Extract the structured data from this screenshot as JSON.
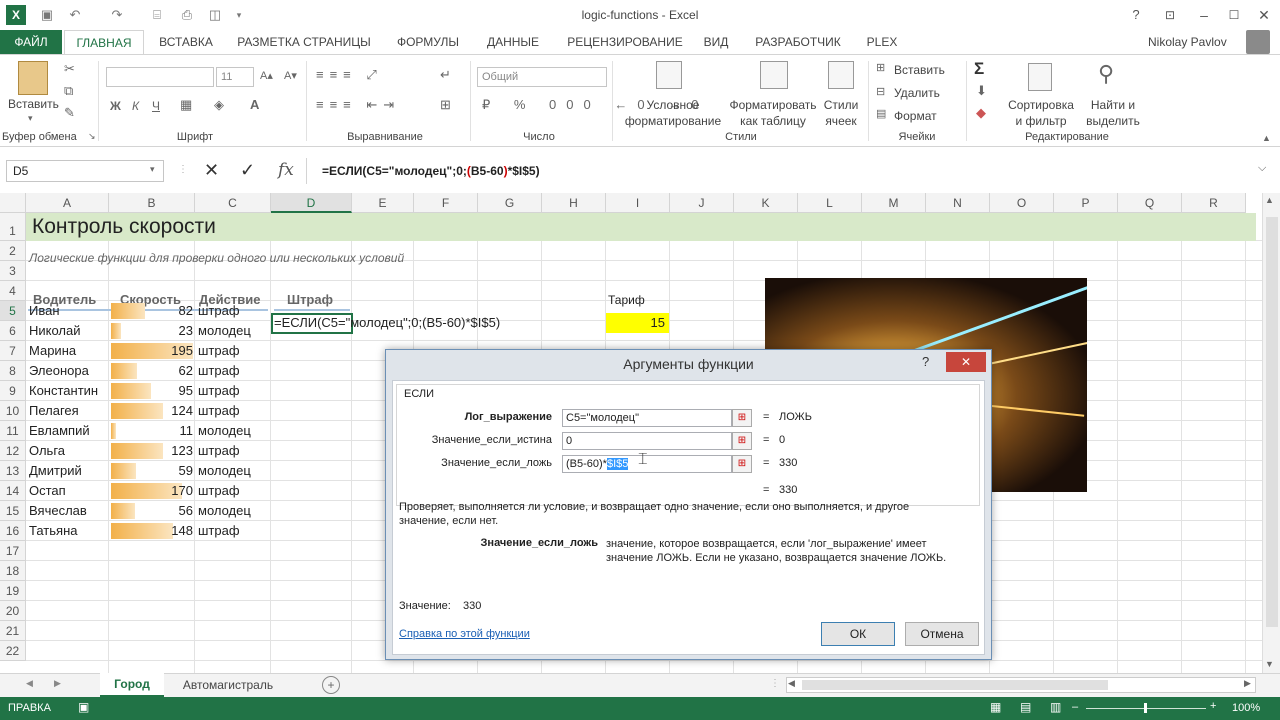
{
  "window": {
    "title": "logic-functions - Excel",
    "user": "Nikolay Pavlov"
  },
  "tabs": [
    "ФАЙЛ",
    "ГЛАВНАЯ",
    "ВСТАВКА",
    "РАЗМЕТКА СТРАНИЦЫ",
    "ФОРМУЛЫ",
    "ДАННЫЕ",
    "РЕЦЕНЗИРОВАНИЕ",
    "ВИД",
    "РАЗРАБОТЧИК",
    "PLEX"
  ],
  "ribbon": {
    "paste": "Вставить",
    "clipboard": "Буфер обмена",
    "font": "Шрифт",
    "font_size": "11",
    "bold": "Ж",
    "italic": "К",
    "underline": "Ч",
    "alignment": "Выравнивание",
    "number_format": "Общий",
    "number": "Число",
    "cond_format": [
      "Условное",
      "форматирование"
    ],
    "table_format": [
      "Форматировать",
      "как таблицу"
    ],
    "cell_styles": [
      "Стили",
      "ячеек"
    ],
    "styles": "Стили",
    "insert": "Вставить",
    "delete": "Удалить",
    "format": "Формат",
    "cells": "Ячейки",
    "sort": [
      "Сортировка",
      "и фильтр"
    ],
    "find": [
      "Найти и",
      "выделить"
    ],
    "editing": "Редактирование"
  },
  "formula_bar": {
    "name_box": "D5",
    "fx": "fx",
    "formula_parts": [
      "=ЕСЛИ(C5=\"молодец\";0;",
      "(",
      "B5-60",
      ")",
      "*$I$5)"
    ]
  },
  "columns": [
    "A",
    "B",
    "C",
    "D",
    "E",
    "F",
    "G",
    "H",
    "I",
    "J",
    "K",
    "L",
    "M",
    "N",
    "O",
    "P",
    "Q",
    "R"
  ],
  "rows": [
    "1",
    "2",
    "3",
    "4",
    "5",
    "6",
    "7",
    "8",
    "9",
    "10",
    "11",
    "12",
    "13",
    "14",
    "15",
    "16",
    "17",
    "18",
    "19",
    "20",
    "21",
    "22"
  ],
  "sheet": {
    "title": "Контроль скорости",
    "subtitle": "Логические функции для проверки одного или нескольких условий",
    "headers": {
      "driver": "Водитель",
      "speed": "Скорость",
      "action": "Действие",
      "fine": "Штраф",
      "rate": "Тариф"
    },
    "rate_value": "15",
    "d5_edit": "=ЕСЛИ(C5=\"молодец\";0;(B5-60)*$I$5)",
    "data": [
      {
        "name": "Иван",
        "speed": 82,
        "action": "штраф"
      },
      {
        "name": "Николай",
        "speed": 23,
        "action": "молодец"
      },
      {
        "name": "Марина",
        "speed": 195,
        "action": "штраф"
      },
      {
        "name": "Элеонора",
        "speed": 62,
        "action": "штраф"
      },
      {
        "name": "Константин",
        "speed": 95,
        "action": "штраф"
      },
      {
        "name": "Пелагея",
        "speed": 124,
        "action": "штраф"
      },
      {
        "name": "Евлампий",
        "speed": 11,
        "action": "молодец"
      },
      {
        "name": "Ольга",
        "speed": 123,
        "action": "штраф"
      },
      {
        "name": "Дмитрий",
        "speed": 59,
        "action": "молодец"
      },
      {
        "name": "Остап",
        "speed": 170,
        "action": "штраф"
      },
      {
        "name": "Вячеслав",
        "speed": 56,
        "action": "молодец"
      },
      {
        "name": "Татьяна",
        "speed": 148,
        "action": "штраф"
      }
    ],
    "speed_max": 195
  },
  "dialog": {
    "title": "Аргументы функции",
    "help_q": "?",
    "close": "✕",
    "func": "ЕСЛИ",
    "args": [
      {
        "label": "Лог_выражение",
        "value": "C5=\"молодец\"",
        "result": "ЛОЖЬ"
      },
      {
        "label": "Значение_если_истина",
        "value": "0",
        "result": "0"
      },
      {
        "label": "Значение_если_ложь",
        "value_prefix": "(B5-60)*",
        "value_sel": "$I$5",
        "result": "330"
      }
    ],
    "eq": "=",
    "total_result": "330",
    "description": "Проверяет, выполняется ли условие, и возвращает одно значение, если оно выполняется, и другое значение, если нет.",
    "arg_name": "Значение_если_ложь",
    "arg_desc": "значение, которое возвращается, если 'лог_выражение' имеет значение ЛОЖЬ. Если не указано, возвращается значение ЛОЖЬ.",
    "value_label": "Значение:",
    "value": "330",
    "help_link": "Справка по этой функции",
    "ok": "ОК",
    "cancel": "Отмена"
  },
  "sheet_tabs": [
    "Город",
    "Автомагистраль"
  ],
  "status": {
    "mode": "ПРАВКА",
    "zoom": "100%"
  }
}
